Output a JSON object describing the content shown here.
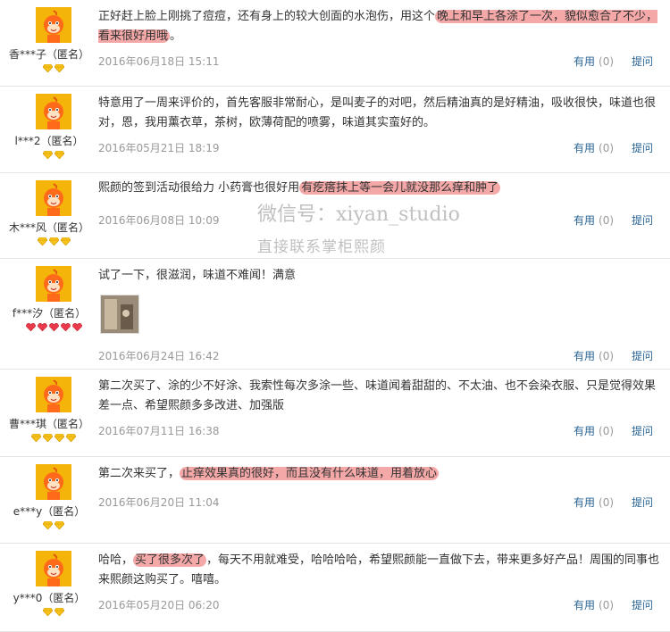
{
  "labels": {
    "useful": "有用",
    "ask": "提问"
  },
  "reviews": [
    {
      "user": "香***子（匿名）",
      "badge_type": "diamond-yellow",
      "badge_count": 2,
      "segments": [
        {
          "text": "正好赶上脸上刚挑了痘痘，还有身上的较大创面的水泡伤，用这个",
          "hl": false
        },
        {
          "text": "晚上和早上各涂了一次，貌似愈合了不少，看来很好用哦",
          "hl": true
        },
        {
          "text": "。",
          "hl": false
        }
      ],
      "date": "2016年06月18日 15:11",
      "useful_count": "(0)"
    },
    {
      "user": "l***2（匿名）",
      "badge_type": "diamond-yellow",
      "badge_count": 2,
      "segments": [
        {
          "text": "特意用了一周来评价的，首先客服非常耐心，是叫麦子的对吧，然后精油真的是好精油，吸收很快，味道也很对，恩，我用薰衣草，茶树，欧薄荷配的喷雾，味道其实蛮好的。",
          "hl": false
        }
      ],
      "date": "2016年05月21日 18:19",
      "useful_count": "(0)"
    },
    {
      "user": "木***风（匿名）",
      "badge_type": "diamond-yellow",
      "badge_count": 3,
      "segments": [
        {
          "text": "熙颜的签到活动很给力 小药膏也很好用",
          "hl": false
        },
        {
          "text": "有疙瘩抹上等一会儿就没那么痒和肿了",
          "hl": true
        }
      ],
      "date": "2016年06月08日 10:09",
      "useful_count": "(0)"
    },
    {
      "user": "f***汐（匿名）",
      "badge_type": "heart-red",
      "badge_count": 5,
      "segments": [
        {
          "text": "试了一下，很滋润，味道不难闻！满意",
          "hl": false
        }
      ],
      "has_photo": true,
      "date": "2016年06月24日 16:42",
      "useful_count": "(0)"
    },
    {
      "user": "曹***琪（匿名）",
      "badge_type": "diamond-yellow",
      "badge_count": 4,
      "segments": [
        {
          "text": "第二次买了、涂的少不好涂、我索性每次多涂一些、味道闻着甜甜的、不太油、也不会染衣服、只是觉得效果差一点、希望熙颜多多改进、加强版",
          "hl": false
        }
      ],
      "date": "2016年07月11日 16:38",
      "useful_count": "(0)"
    },
    {
      "user": "e***y（匿名）",
      "badge_type": "diamond-yellow",
      "badge_count": 2,
      "segments": [
        {
          "text": "第二次来买了，",
          "hl": false
        },
        {
          "text": "止痒效果真的很好，而且没有什么味道，用着放心",
          "hl": true
        }
      ],
      "date": "2016年06月20日 11:04",
      "useful_count": "(0)"
    },
    {
      "user": "y***0（匿名）",
      "badge_type": "diamond-yellow",
      "badge_count": 2,
      "segments": [
        {
          "text": "哈哈，",
          "hl": false
        },
        {
          "text": "买了很多次了",
          "hl": true
        },
        {
          "text": "，每天不用就难受，哈哈哈哈，希望熙颜能一直做下去，带来更多好产品！周围的同事也来熙颜这购买了。嘻嘻。",
          "hl": false
        }
      ],
      "date": "2016年05月20日 06:20",
      "useful_count": "(0)"
    }
  ],
  "watermark": {
    "line1": "微信号：xiyan_studio",
    "line2": "直接联系掌柜熙颜"
  },
  "colors": {
    "highlight": "#f5a8a8",
    "link": "#2a6496",
    "avatar": "#f5b40a"
  }
}
